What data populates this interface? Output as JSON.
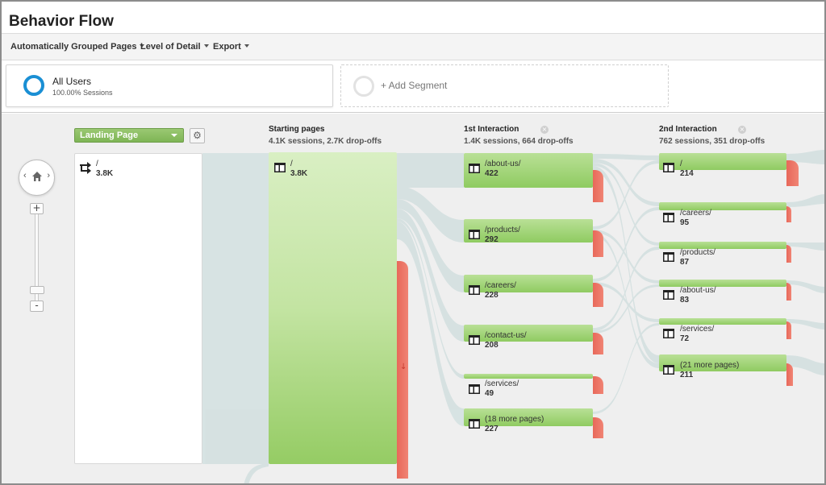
{
  "page": {
    "title": "Behavior Flow"
  },
  "toolbar": {
    "grouping_label": "Automatically Grouped Pages",
    "detail_label": "Level of Detail",
    "export_label": "Export"
  },
  "segments": {
    "active": {
      "name": "All Users",
      "sessions": "100.00% Sessions",
      "color": "#1a8fd4"
    },
    "add_label": "+ Add Segment"
  },
  "zoom": {
    "left_arrow": "‹",
    "right_arrow": "›",
    "plus": "+",
    "minus": "-",
    "home_icon": "home-icon"
  },
  "dimension": {
    "selected": "Landing Page",
    "settings_icon": "gear-icon"
  },
  "landing": {
    "name": "/",
    "value": "3.8K"
  },
  "columns": {
    "starting": {
      "title": "Starting pages",
      "stats": "4.1K sessions, 2.7K drop-offs"
    },
    "first": {
      "title": "1st Interaction",
      "stats": "1.4K sessions, 664 drop-offs"
    },
    "second": {
      "title": "2nd Interaction",
      "stats": "762 sessions, 351 drop-offs"
    }
  },
  "starting_node": {
    "name": "/",
    "value": "3.8K"
  },
  "first_nodes": [
    {
      "name": "/about-us/",
      "value": "422"
    },
    {
      "name": "/products/",
      "value": "292"
    },
    {
      "name": "/careers/",
      "value": "228"
    },
    {
      "name": "/contact-us/",
      "value": "208"
    },
    {
      "name": "/services/",
      "value": "49"
    },
    {
      "name": "(18 more pages)",
      "value": "227"
    }
  ],
  "second_nodes": [
    {
      "name": "/",
      "value": "214"
    },
    {
      "name": "/careers/",
      "value": "95"
    },
    {
      "name": "/products/",
      "value": "87"
    },
    {
      "name": "/about-us/",
      "value": "83"
    },
    {
      "name": "/services/",
      "value": "72"
    },
    {
      "name": "(21 more pages)",
      "value": "211"
    }
  ],
  "colors": {
    "node_green": "#8fcb61",
    "dropoff_red": "#e8685a",
    "flow_gray": "#d7e3e3"
  }
}
